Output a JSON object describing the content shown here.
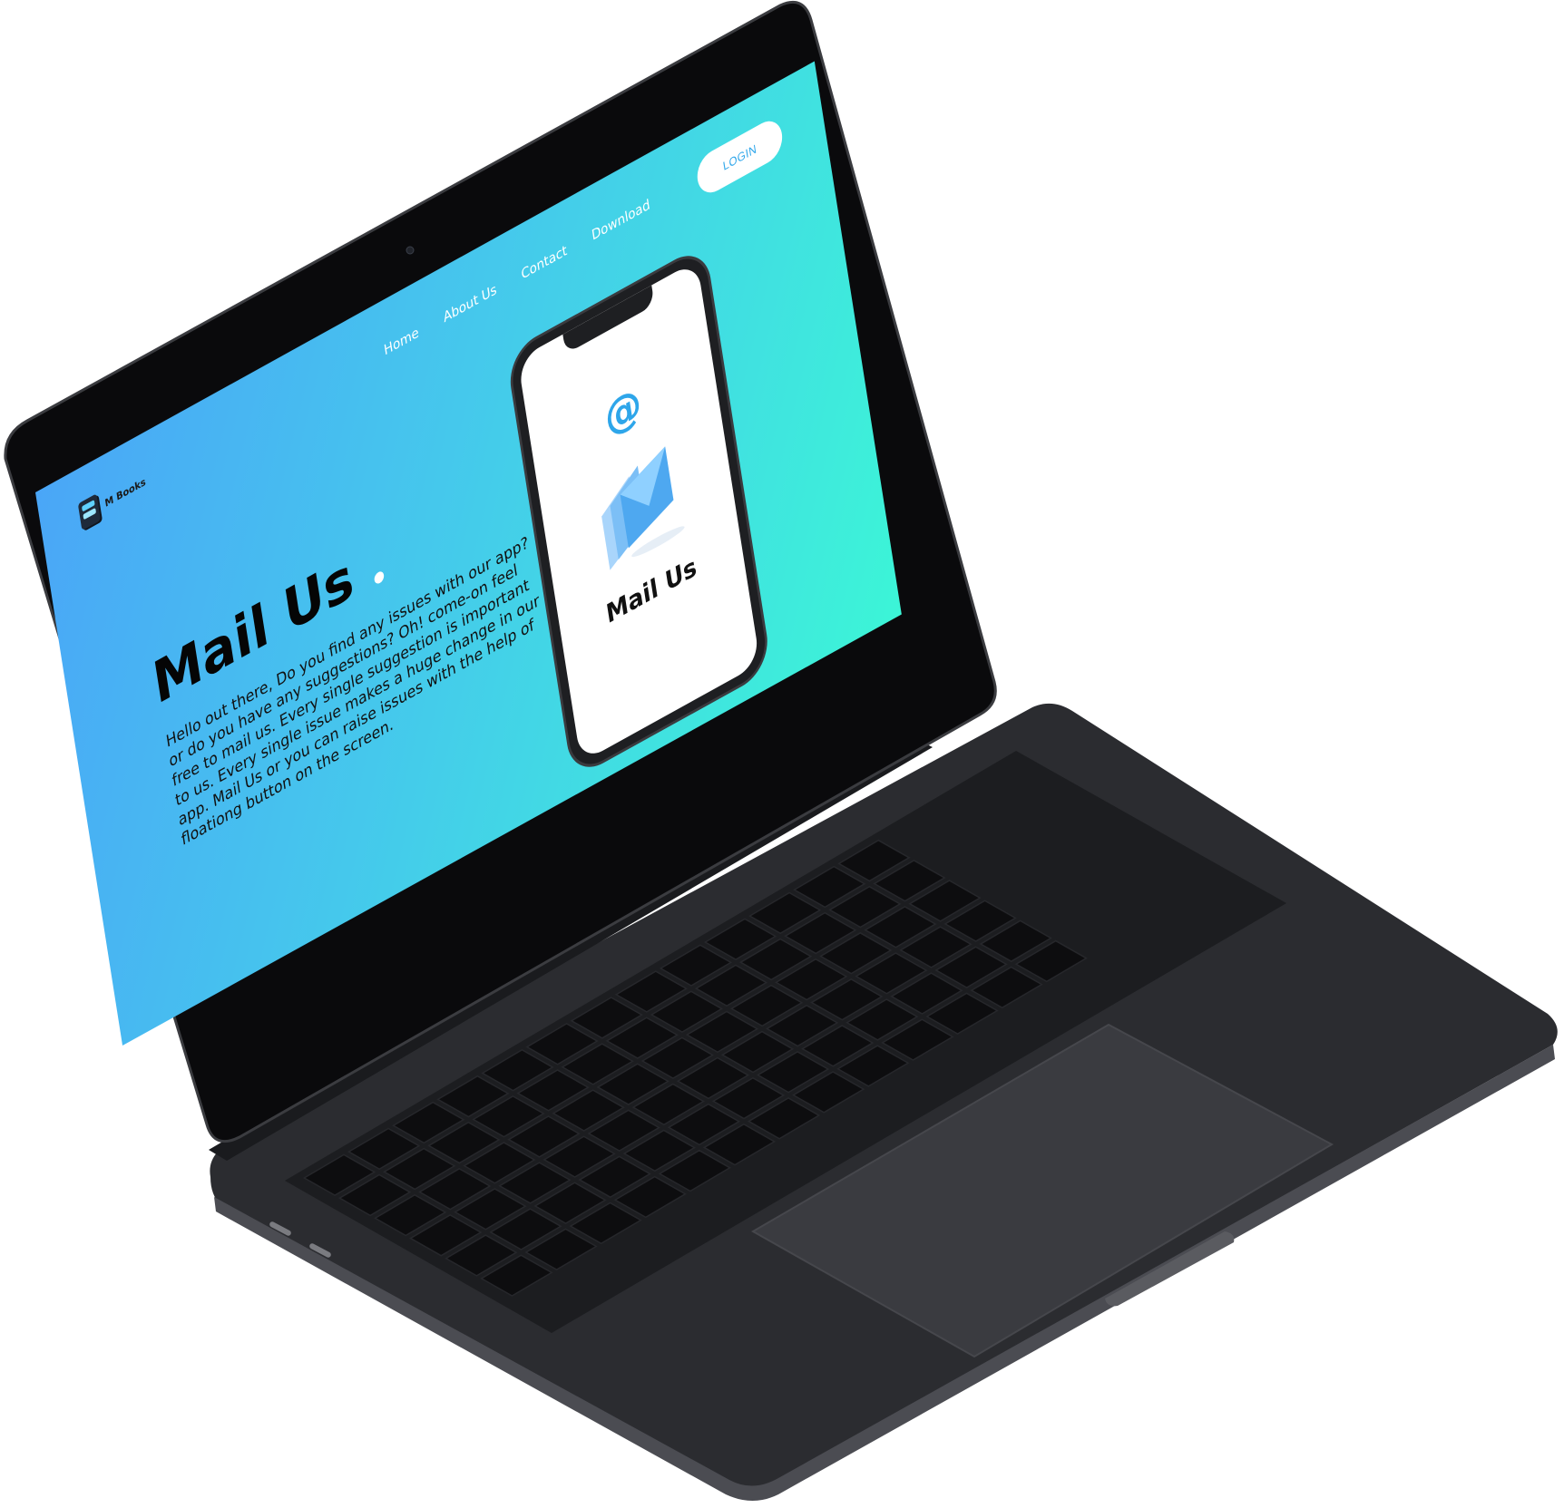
{
  "site": {
    "brand": "M Books",
    "nav": [
      "Home",
      "About Us",
      "Contact",
      "Download"
    ],
    "login_label": "LOGIN"
  },
  "hero": {
    "title": "Mail Us",
    "body": "Hello out there, Do you find any issues with our app? or do you have any suggestions? Oh! come-on feel free to mail us. Every single suggestion is important to us. Every single issue makes a huge change in our app. Mail Us or you can raise issues with the help of floationg button on the screen."
  },
  "phone": {
    "at_symbol": "@",
    "label": "Mail Us"
  },
  "icons": {
    "logo": "phone-app-icon",
    "email": "at-sign-icon",
    "mail": "envelope-icon"
  },
  "colors": {
    "gradient_start": "#4aa6f7",
    "gradient_end": "#3cf5d7",
    "accent": "#2ea6ea",
    "laptop_body": "#2b2c30",
    "key": "#0d0d0f"
  }
}
